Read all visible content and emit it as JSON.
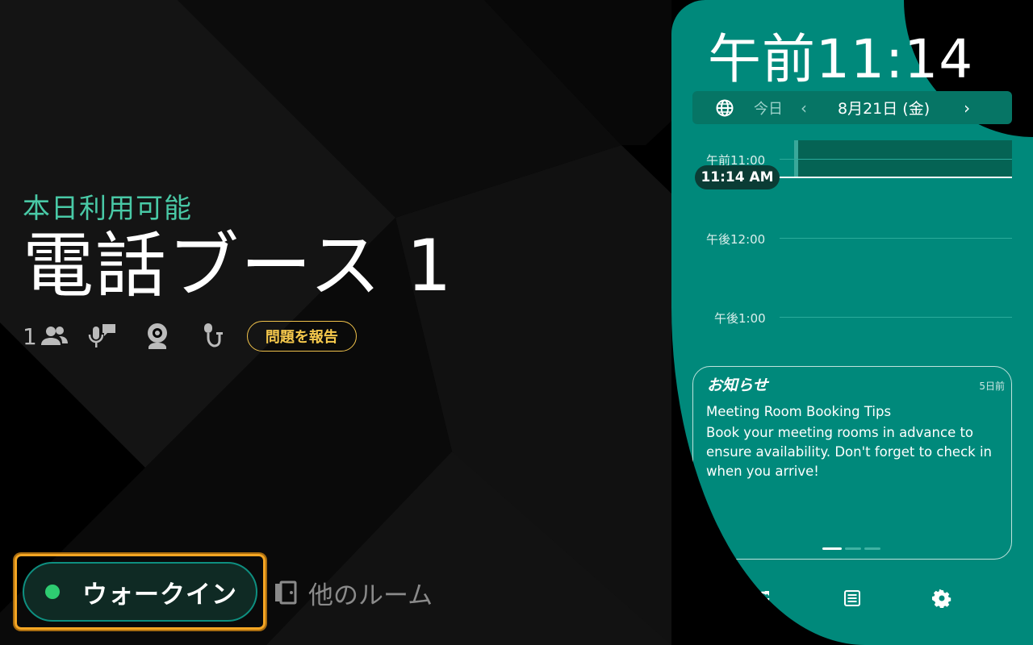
{
  "room": {
    "status": "本日利用可能",
    "name": "電話ブース 1",
    "capacity": "1",
    "report_label": "問題を報告",
    "amenities": [
      "people-icon",
      "voice-chat-icon",
      "webcam-icon",
      "microphone-icon"
    ]
  },
  "actions": {
    "walk_in_label": "ウォークイン",
    "other_rooms_label": "他のルーム"
  },
  "panel": {
    "clock": "午前11:14",
    "date_bar": {
      "today_label": "今日",
      "prev": "‹",
      "date": "8月21日 (金)",
      "next": "›"
    },
    "timeline": {
      "hours": [
        "午前11:00",
        "午後12:00",
        "午後1:00"
      ],
      "now_label": "11:14 AM"
    },
    "notice": {
      "title": "お知らせ",
      "ago": "5日前",
      "headline": "Meeting Room Booking Tips",
      "body": "Book your meeting rooms in advance to ensure availability. Don't forget to check in when you arrive!"
    }
  },
  "colors": {
    "accent_teal": "#00897b",
    "status_green": "#49c9a6",
    "report_yellow": "#f5c84c",
    "walkin_border": "#f5a623"
  }
}
